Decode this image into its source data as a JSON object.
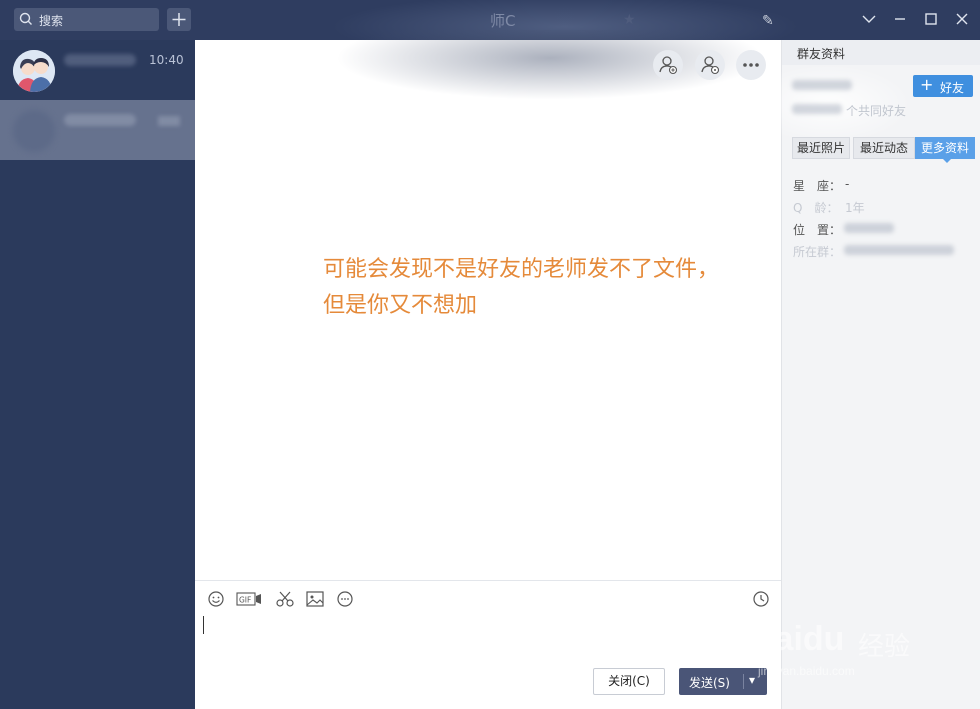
{
  "titlebar": {
    "search_placeholder": "搜索",
    "chat_title": "师C"
  },
  "conversations": [
    {
      "time": "10:40"
    },
    {
      "time": ""
    }
  ],
  "chat": {
    "message_line1": "可能会发现不是好友的老师发不了文件，",
    "message_line2": "但是你又不想加",
    "close_label": "关闭(C)",
    "send_label": "发送(S)"
  },
  "profile_panel": {
    "header": "群友资料",
    "add_friend_label": "好友",
    "mutual_friends_suffix": "个共同好友",
    "tabs": [
      "最近照片",
      "最近动态",
      "更多资料"
    ],
    "active_tab": "更多资料",
    "fields": {
      "zodiac_label": "星　座：",
      "zodiac_value": "-",
      "age_label": "Q　龄：",
      "age_value": "1年",
      "location_label": "位　置：",
      "group_label": "所在群："
    }
  },
  "watermark": {
    "brand": "Baidu",
    "brand_cn": "经验",
    "url": "jingyan.baidu.com"
  },
  "colors": {
    "sidebar_bg": "#2b3a5c",
    "message_orange": "#e58a3a",
    "accent_blue": "#3f8fdf"
  }
}
